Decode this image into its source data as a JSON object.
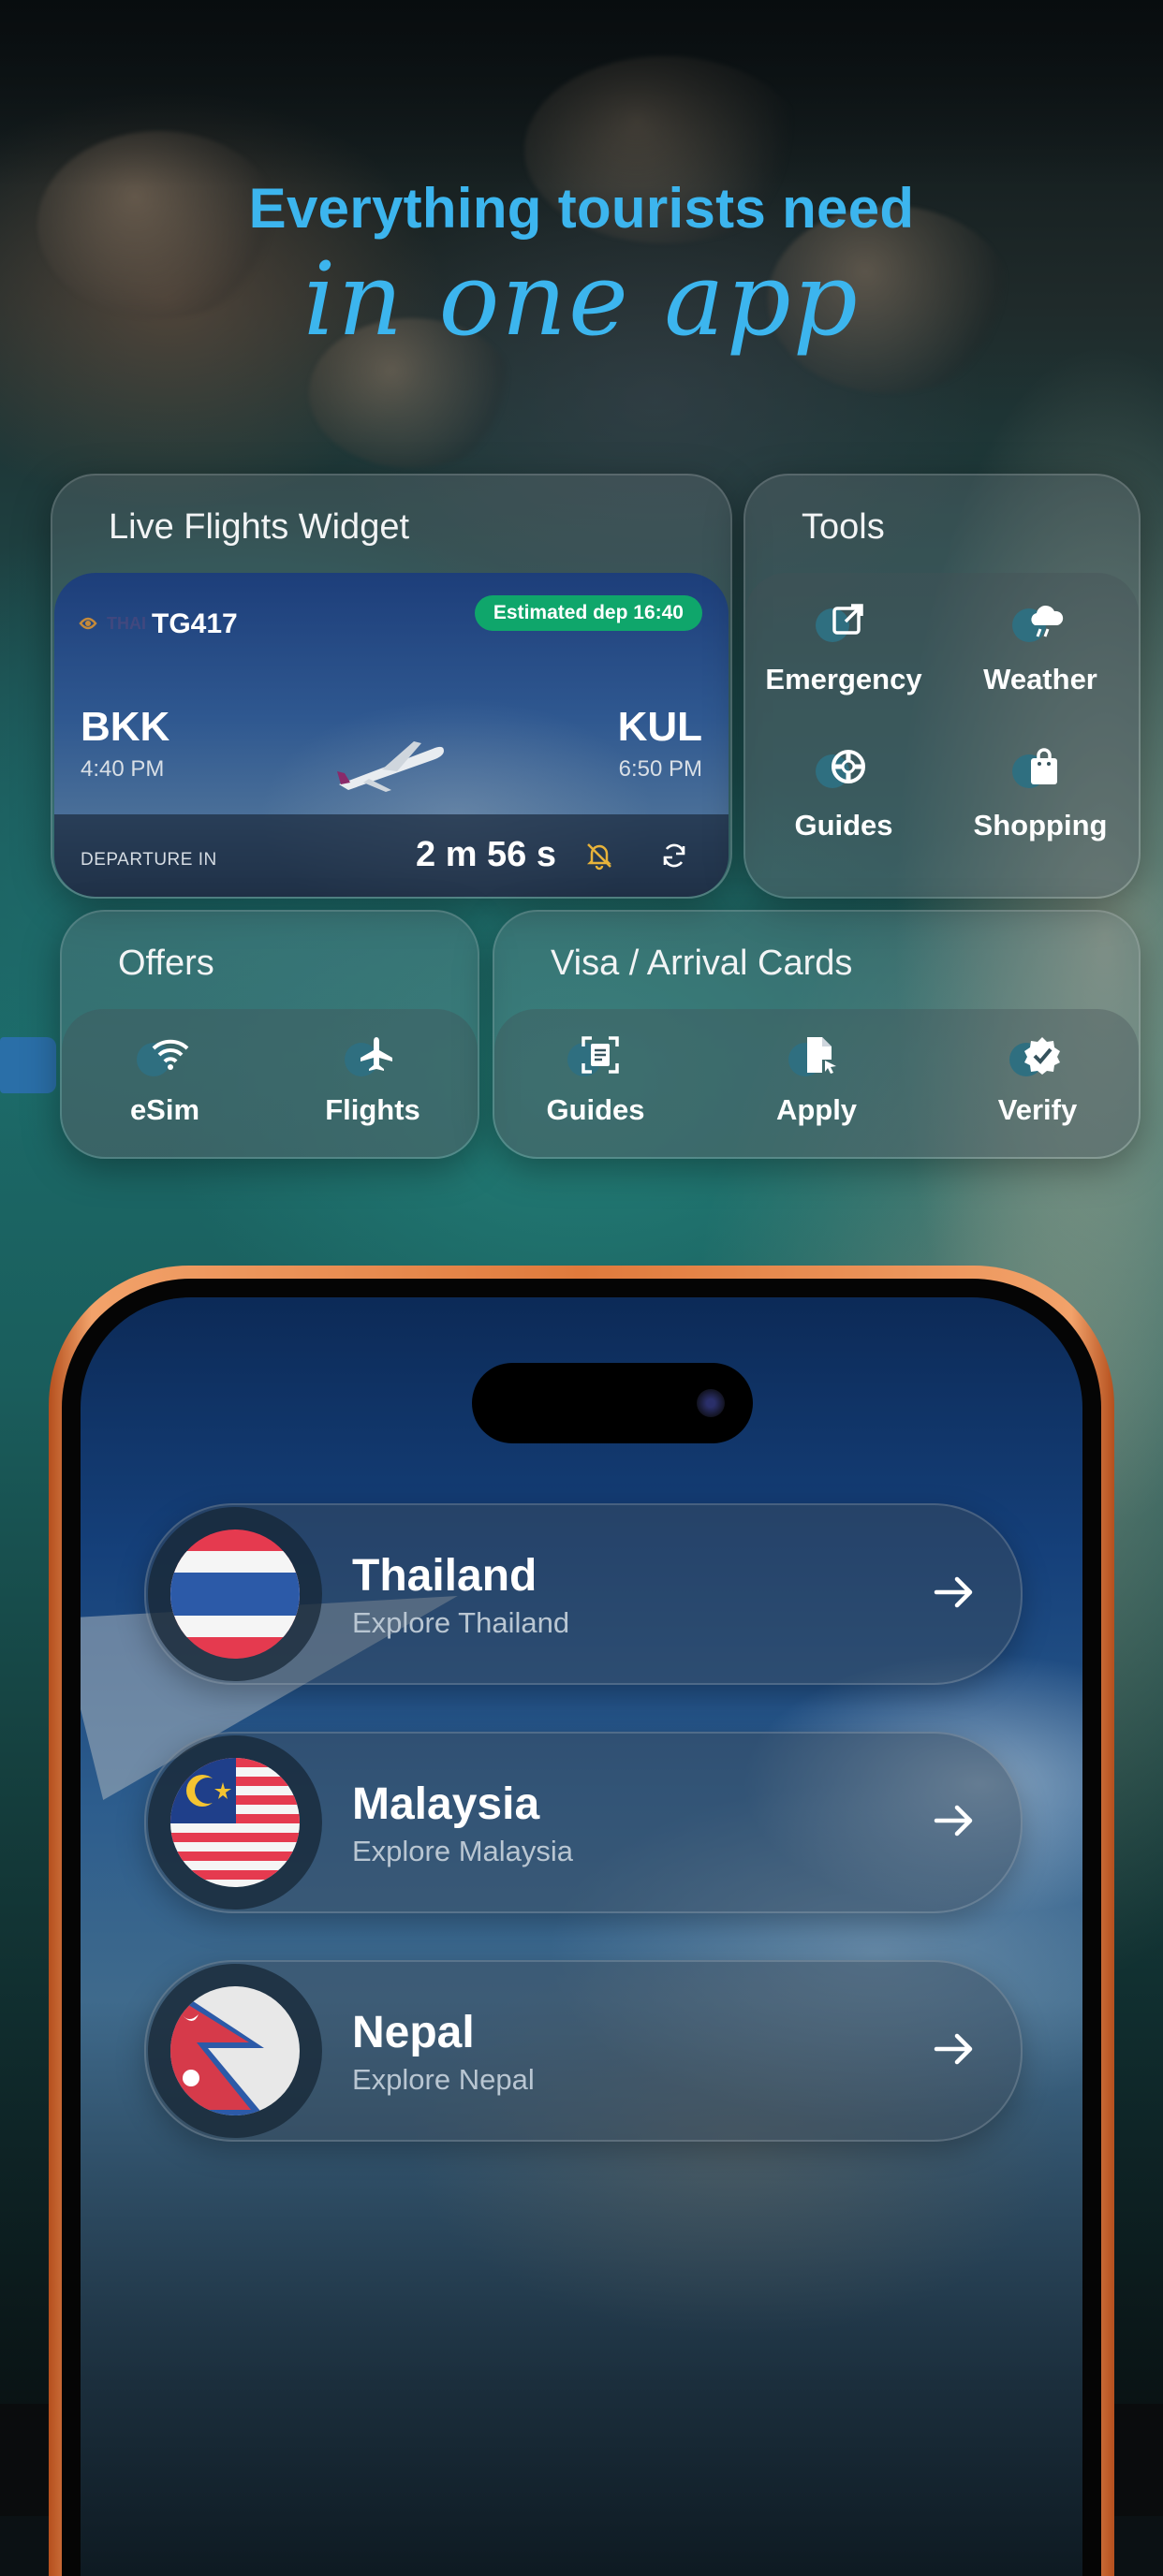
{
  "headline": {
    "line1": "Everything tourists need",
    "line2": "in one app"
  },
  "flights_widget": {
    "title": "Live Flights Widget",
    "airline_logo_letters": "THAI",
    "flight_number": "TG417",
    "status_badge": "Estimated dep 16:40",
    "origin": {
      "code": "BKK",
      "time": "4:40 PM"
    },
    "destination": {
      "code": "KUL",
      "time": "6:50 PM"
    },
    "departure_label": "DEPARTURE IN",
    "countdown": "2 m 56 s"
  },
  "tools": {
    "title": "Tools",
    "items": [
      {
        "label": "Emergency",
        "icon": "external-link-icon"
      },
      {
        "label": "Weather",
        "icon": "storm-cloud-icon"
      },
      {
        "label": "Guides",
        "icon": "lifebuoy-icon"
      },
      {
        "label": "Shopping",
        "icon": "shopping-bag-icon"
      }
    ]
  },
  "offers": {
    "title": "Offers",
    "items": [
      {
        "label": "eSim",
        "icon": "wifi-icon"
      },
      {
        "label": "Flights",
        "icon": "airplane-icon"
      }
    ]
  },
  "visa": {
    "title": "Visa / Arrival Cards",
    "items": [
      {
        "label": "Guides",
        "icon": "scan-document-icon"
      },
      {
        "label": "Apply",
        "icon": "file-cursor-icon"
      },
      {
        "label": "Verify",
        "icon": "verified-badge-icon"
      }
    ]
  },
  "countries": [
    {
      "name": "Thailand",
      "subtitle": "Explore Thailand",
      "flag": "thailand-flag"
    },
    {
      "name": "Malaysia",
      "subtitle": "Explore Malaysia",
      "flag": "malaysia-flag"
    },
    {
      "name": "Nepal",
      "subtitle": "Explore Nepal",
      "flag": "nepal-flag"
    }
  ],
  "colors": {
    "accent": "#3cb5ee",
    "badge_green": "#0fa66b",
    "phone_frame": "#e07a3c"
  }
}
